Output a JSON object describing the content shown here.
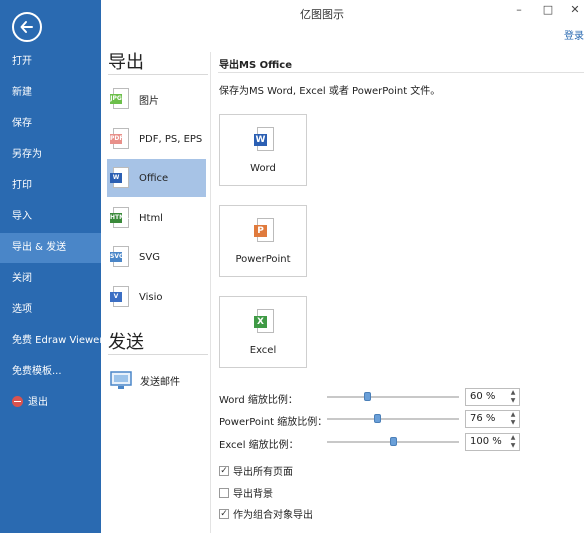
{
  "window": {
    "title": "亿图图示",
    "login_label": "登录",
    "minimize": "–",
    "maximize": "□",
    "close": "✕"
  },
  "sidebar": {
    "back_icon": "arrow-left-circle-icon",
    "items": [
      {
        "label": "打开"
      },
      {
        "label": "新建"
      },
      {
        "label": "保存"
      },
      {
        "label": "另存为"
      },
      {
        "label": "打印"
      },
      {
        "label": "导入"
      },
      {
        "label": "导出 & 发送",
        "active": true
      },
      {
        "label": "关闭"
      },
      {
        "label": "选项"
      },
      {
        "label": "免费 Edraw Viewer"
      },
      {
        "label": "免费模板..."
      },
      {
        "label": "退出",
        "icon": "exit-icon"
      }
    ],
    "colors": {
      "background": "#2a6ab1",
      "active": "#4a86c8"
    }
  },
  "export": {
    "heading": "导出",
    "categories": [
      {
        "label": "图片",
        "icon_tag": "JPG",
        "color": "#6cbf4a"
      },
      {
        "label": "PDF, PS, EPS",
        "icon_tag": "PDF",
        "color": "#e8908a"
      },
      {
        "label": "Office",
        "icon_tag": "W",
        "color": "#2b5fb3",
        "active": true
      },
      {
        "label": "Html",
        "icon_tag": "HTML",
        "color": "#3a8a3a"
      },
      {
        "label": "SVG",
        "icon_tag": "SVG",
        "color": "#4a86c8"
      },
      {
        "label": "Visio",
        "icon_tag": "V",
        "color": "#3c6fc4"
      }
    ]
  },
  "send": {
    "heading": "发送",
    "items": [
      {
        "label": "发送邮件",
        "icon": "email-send-icon"
      }
    ]
  },
  "panel": {
    "title": "导出MS Office",
    "description": "保存为MS Word, Excel 或者 PowerPoint 文件。",
    "formats": [
      {
        "label": "Word",
        "icon_tag": "W",
        "color": "#2b5fb3"
      },
      {
        "label": "PowerPoint",
        "icon_tag": "P",
        "color": "#e07a3c"
      },
      {
        "label": "Excel",
        "icon_tag": "X",
        "color": "#3f9a45"
      }
    ],
    "zoom": [
      {
        "label": "Word 缩放比例：",
        "value": "60 %",
        "level": 0.3
      },
      {
        "label": "PowerPoint 缩放比例：",
        "value": "76 %",
        "level": 0.38
      },
      {
        "label": "Excel 缩放比例：",
        "value": "100 %",
        "level": 0.5
      }
    ],
    "options": [
      {
        "label": "导出所有页面",
        "checked": true
      },
      {
        "label": "导出背景",
        "checked": false
      },
      {
        "label": "作为组合对象导出",
        "checked": true
      }
    ]
  }
}
